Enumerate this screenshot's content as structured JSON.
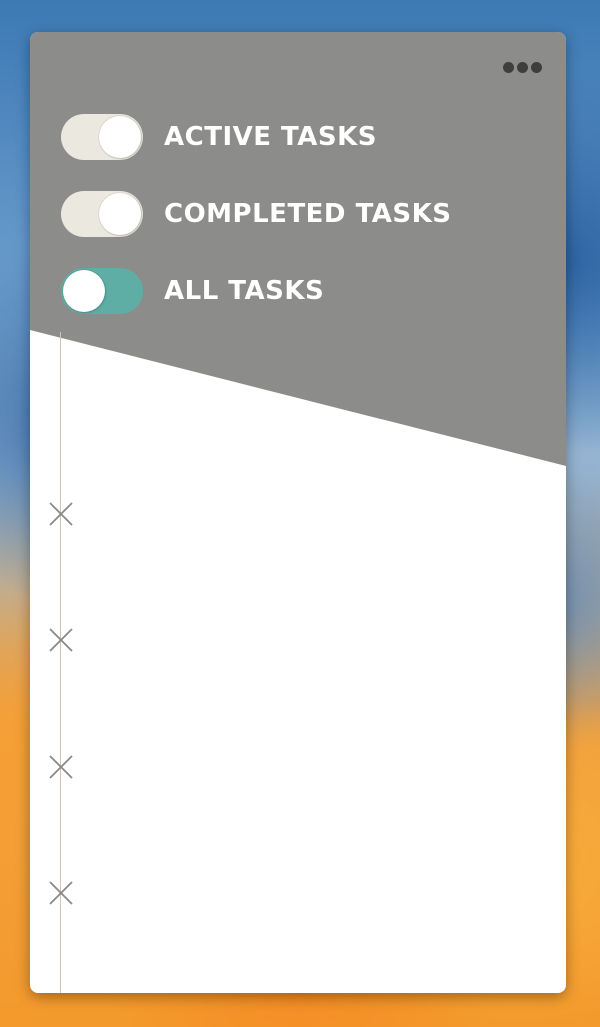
{
  "colors": {
    "header": "#8c8c8a",
    "toggle_off": "#ebe8df",
    "toggle_on": "#5faea6",
    "text": "#ffffff",
    "icon": "#8a8a8a",
    "timeline": "#d6c3b8"
  },
  "header": {
    "menu_icon": "more-dots-icon"
  },
  "filters": [
    {
      "label": "ACTIVE TASKS",
      "toggle_state": "off"
    },
    {
      "label": "COMPLETED TASKS",
      "toggle_state": "off"
    },
    {
      "label": "ALL TASKS",
      "toggle_state": "on"
    }
  ],
  "tasks": [
    {
      "icon": "close-x-icon"
    },
    {
      "icon": "close-x-icon"
    },
    {
      "icon": "close-x-icon"
    },
    {
      "icon": "close-x-icon"
    }
  ]
}
